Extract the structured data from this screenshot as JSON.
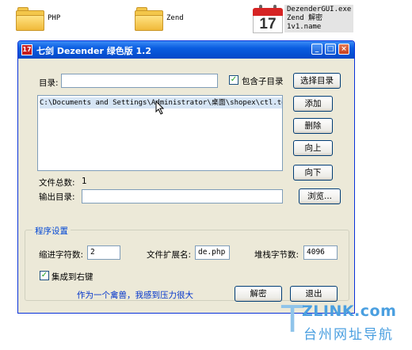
{
  "desktop": {
    "items": [
      {
        "label": "PHP"
      },
      {
        "label": "Zend"
      },
      {
        "label_lines": [
          "DezenderGUI.exe",
          "Zend 解密",
          "1v1.name"
        ],
        "calendar_day": "17"
      }
    ]
  },
  "window": {
    "title": "七剑 Dezender 绿色版 1.2",
    "app_icon_text": "17",
    "controls": {
      "minimize": "_",
      "maximize": "□",
      "close": "×"
    }
  },
  "form": {
    "dir_label": "目录:",
    "dir_value": "",
    "include_subdirs_label": "包含子目录",
    "include_subdirs_checked": true,
    "select_dir_button": "选择目录",
    "add_button": "添加",
    "delete_button": "删除",
    "up_button": "向上",
    "down_button": "向下",
    "file_list": [
      "C:\\Documents and Settings\\Administrator\\桌面\\shopex\\ctl.too"
    ],
    "total_files_label": "文件总数:",
    "total_files_value": "1",
    "output_dir_label": "输出目录:",
    "output_dir_value": "",
    "browse_button": "浏览..."
  },
  "settings": {
    "legend": "程序设置",
    "indent_label": "缩进字符数:",
    "indent_value": "2",
    "ext_label": "文件扩展名:",
    "ext_value": "de.php",
    "stack_label": "堆栈字节数:",
    "stack_value": "4096",
    "integrate_label": "集成到右键",
    "integrate_checked": true,
    "slogan": "作为一个禽兽，我感到压力很大",
    "decrypt_button": "解密",
    "exit_button": "退出"
  },
  "watermark": {
    "letter": "T",
    "domain": "ZLINK.com",
    "text_cn": "台州网址导航"
  },
  "colors": {
    "titlebar": "#0a5de0",
    "window_bg": "#ece9d8",
    "group_legend": "#0046d5",
    "slogan": "#0033cc",
    "watermark": "#4a9fe0"
  }
}
